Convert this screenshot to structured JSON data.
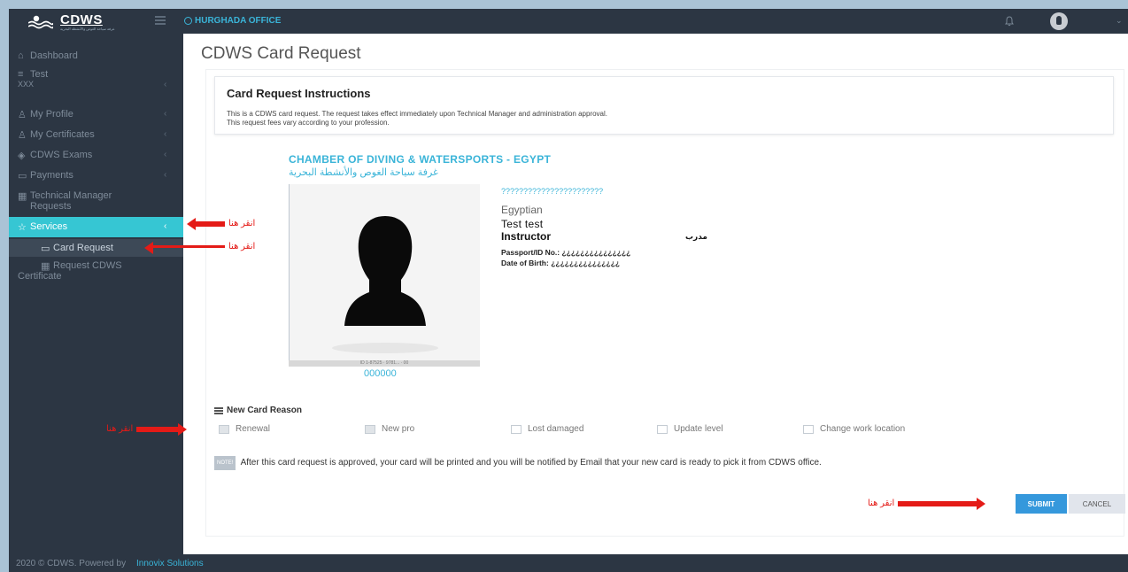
{
  "header": {
    "logo_text": "CDWS",
    "logo_subtext": "غرفة سياحة الغوص والأنشطة البحرية",
    "office": "HURGHADA OFFICE",
    "icons": [
      "menu-icon",
      "globe-icon",
      "bell-icon",
      "user-avatar",
      "chevron-down-icon"
    ]
  },
  "sidebar": {
    "items": [
      {
        "label": "Dashboard",
        "icon": "home-icon"
      },
      {
        "label": "Test",
        "sublabel": "XXX",
        "icon": "list-icon"
      },
      {
        "label": "My Profile",
        "icon": "user-icon"
      },
      {
        "label": "My Certificates",
        "icon": "users-icon"
      },
      {
        "label": "CDWS Exams",
        "icon": "graduation-icon"
      },
      {
        "label": "Payments",
        "icon": "folder-icon"
      },
      {
        "label": "Technical Manager Requests",
        "icon": "grid-icon"
      },
      {
        "label": "Services",
        "icon": "star-icon",
        "active": true
      }
    ],
    "subitems": [
      {
        "label": "Card Request",
        "icon": "card-icon",
        "active": true
      },
      {
        "label": "Request CDWS Certificate",
        "icon": "grid-icon"
      }
    ]
  },
  "page": {
    "title": "CDWS Card Request",
    "instructions": {
      "heading": "Card Request Instructions",
      "line1": "This is a CDWS card request. The request takes effect immediately upon Technical Manager and administration approval.",
      "line2": "This request fees vary according to your profession."
    },
    "card": {
      "title": "CHAMBER OF DIVING & WATERSPORTS - EGYPT",
      "title_ar": "غرفة سياحة الغوص والأنشطة البحرية",
      "qmarks": "???????????????????????",
      "nationality": "Egyptian",
      "name": "Test  test",
      "profession": "Instructor",
      "profession_ar": "مدرب",
      "passport": "Passport/ID No.: ¿¿¿¿¿¿¿¿¿¿¿¿¿¿¿",
      "dob": "Date of Birth: ¿¿¿¿¿¿¿¿¿¿¿¿¿¿¿",
      "number": "000000",
      "photo_strip": "ID 1-87525 · 9781... · 00"
    },
    "reason": {
      "title": "New Card Reason",
      "options": [
        "Renewal",
        "New pro",
        "Lost damaged",
        "Update level",
        "Change work location"
      ]
    },
    "note": {
      "badge": "NOTE!",
      "text": "After this card request is approved, your card will be printed and you will be notified by Email that your new card is ready to pick it from CDWS office."
    },
    "buttons": {
      "submit": "SUBMIT",
      "cancel": "CANCEL"
    }
  },
  "annotations": {
    "click_here": "انقر هنا"
  },
  "footer": {
    "text": "2020 © CDWS. Powered by",
    "link": "Innovix Solutions"
  },
  "colors": {
    "accent": "#3ab4d8",
    "active_nav": "#36c6d3",
    "sidebar": "#2c3643",
    "submit": "#3598dc",
    "annotation": "#e41b17"
  }
}
